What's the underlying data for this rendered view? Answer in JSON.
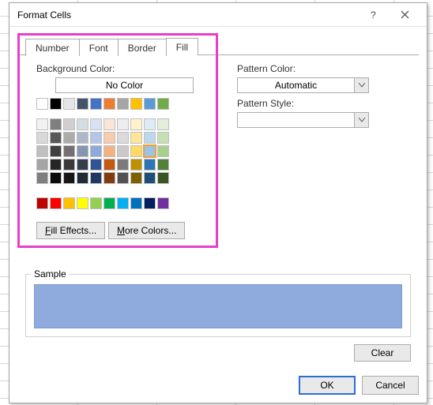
{
  "dialog": {
    "title": "Format Cells"
  },
  "tabs": {
    "items": [
      {
        "label": "Number"
      },
      {
        "label": "Font"
      },
      {
        "label": "Border"
      },
      {
        "label": "Fill"
      }
    ],
    "active_index": 3
  },
  "fill": {
    "background_label": "Background Color:",
    "no_color_label": "No Color",
    "standard_row": [
      "#ffffff",
      "#000000",
      "#e7e6e6",
      "#44546a",
      "#4472c4",
      "#ed7d31",
      "#a5a5a5",
      "#ffc000",
      "#5b9bd5",
      "#70ad47"
    ],
    "theme_grid": [
      [
        "#f2f2f2",
        "#7f7f7f",
        "#d0cece",
        "#d6dce4",
        "#d9e2f3",
        "#fbe5d5",
        "#ededed",
        "#fff2cc",
        "#deebf6",
        "#e2efd9"
      ],
      [
        "#d8d8d8",
        "#595959",
        "#aeabab",
        "#adb9ca",
        "#b4c6e7",
        "#f7cbac",
        "#dbdbdb",
        "#fee599",
        "#bdd7ee",
        "#c5e0b3"
      ],
      [
        "#bfbfbf",
        "#3f3f3f",
        "#757070",
        "#8496b0",
        "#8eaadb",
        "#f4b183",
        "#c9c9c9",
        "#ffd965",
        "#9cc3e5",
        "#a8d08d"
      ],
      [
        "#a5a5a5",
        "#262626",
        "#3a3838",
        "#333f4f",
        "#2f5496",
        "#c55a11",
        "#7b7b7b",
        "#bf9000",
        "#2e75b5",
        "#538135"
      ],
      [
        "#7f7f7f",
        "#0c0c0c",
        "#171616",
        "#222a35",
        "#1f3864",
        "#833c0b",
        "#525252",
        "#7f6000",
        "#1e4e79",
        "#375623"
      ]
    ],
    "selected": {
      "row": 2,
      "col": 8
    },
    "accent_row": [
      "#c00000",
      "#ff0000",
      "#ffc000",
      "#ffff00",
      "#92d050",
      "#00b050",
      "#00b0f0",
      "#0070c0",
      "#002060",
      "#7030a0"
    ],
    "fill_effects_label": "Fill Effects...",
    "more_colors_label": "More Colors..."
  },
  "pattern": {
    "color_label": "Pattern Color:",
    "color_value": "Automatic",
    "style_label": "Pattern Style:",
    "style_value": ""
  },
  "sample": {
    "label": "Sample",
    "color": "#8faadc"
  },
  "buttons": {
    "clear": "Clear",
    "ok": "OK",
    "cancel": "Cancel"
  }
}
